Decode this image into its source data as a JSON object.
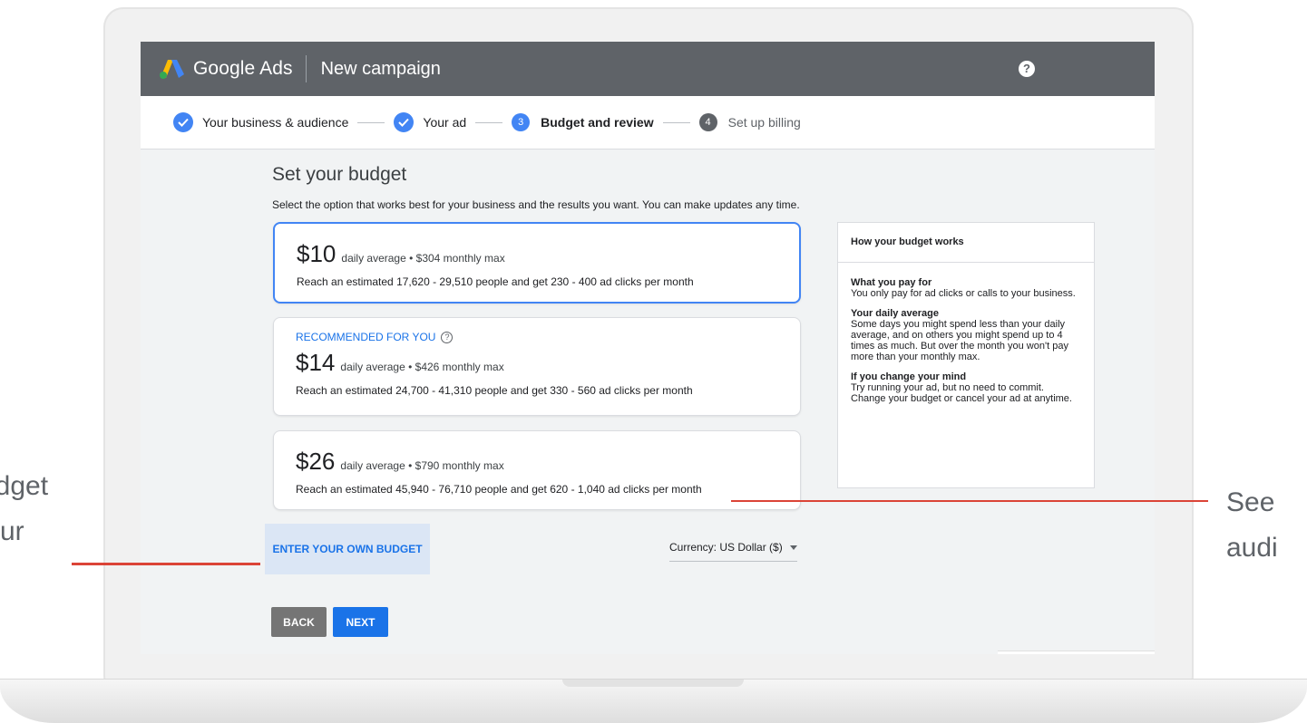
{
  "callouts": {
    "left_line1": "udget",
    "left_line2": "ur",
    "right_line1": "See",
    "right_line2": "audi"
  },
  "topbar": {
    "brand": "Google Ads",
    "campaign_title": "New campaign",
    "help_label": "?"
  },
  "stepper": {
    "steps": [
      {
        "label": "Your business & audience",
        "state": "done"
      },
      {
        "label": "Your ad",
        "state": "done"
      },
      {
        "number": "3",
        "label": "Budget and review",
        "state": "active"
      },
      {
        "number": "4",
        "label": "Set up billing",
        "state": "upcoming"
      }
    ]
  },
  "main": {
    "title": "Set your budget",
    "subtitle": "Select the option that works best for your business and the results you want. You can make updates any time.",
    "options": [
      {
        "price": "$10",
        "desc": "daily average • $304 monthly max",
        "reach": "Reach an estimated 17,620 - 29,510 people and get 230 - 400 ad clicks per month",
        "selected": true
      },
      {
        "badge": "RECOMMENDED FOR YOU",
        "price": "$14",
        "desc": "daily average • $426 monthly max",
        "reach": "Reach an estimated 24,700 - 41,310 people and get 330 - 560 ad clicks per month"
      },
      {
        "price": "$26",
        "desc": "daily average • $790 monthly max",
        "reach": "Reach an estimated 45,940 - 76,710 people and get 620 - 1,040 ad clicks per month"
      }
    ],
    "own_budget_label": "ENTER YOUR OWN BUDGET",
    "currency_label": "Currency: US Dollar ($)",
    "back_label": "BACK",
    "next_label": "NEXT"
  },
  "info_panel": {
    "heading": "How your budget works",
    "sections": [
      {
        "title": "What you pay for",
        "body": "You only pay for ad clicks or calls to your business."
      },
      {
        "title": "Your daily average",
        "body": "Some days you might spend less than your daily average, and on others you might spend up to 4 times as much. But over the month you won't pay more than your monthly max."
      },
      {
        "title": "If you change your mind",
        "body": "Try running your ad, but no need to commit. Change your budget or cancel your ad at anytime."
      }
    ]
  },
  "colors": {
    "topbar": "#5f6368",
    "accent_blue": "#4285f4",
    "link_blue": "#1a73e8",
    "leader_red": "#db4437"
  }
}
